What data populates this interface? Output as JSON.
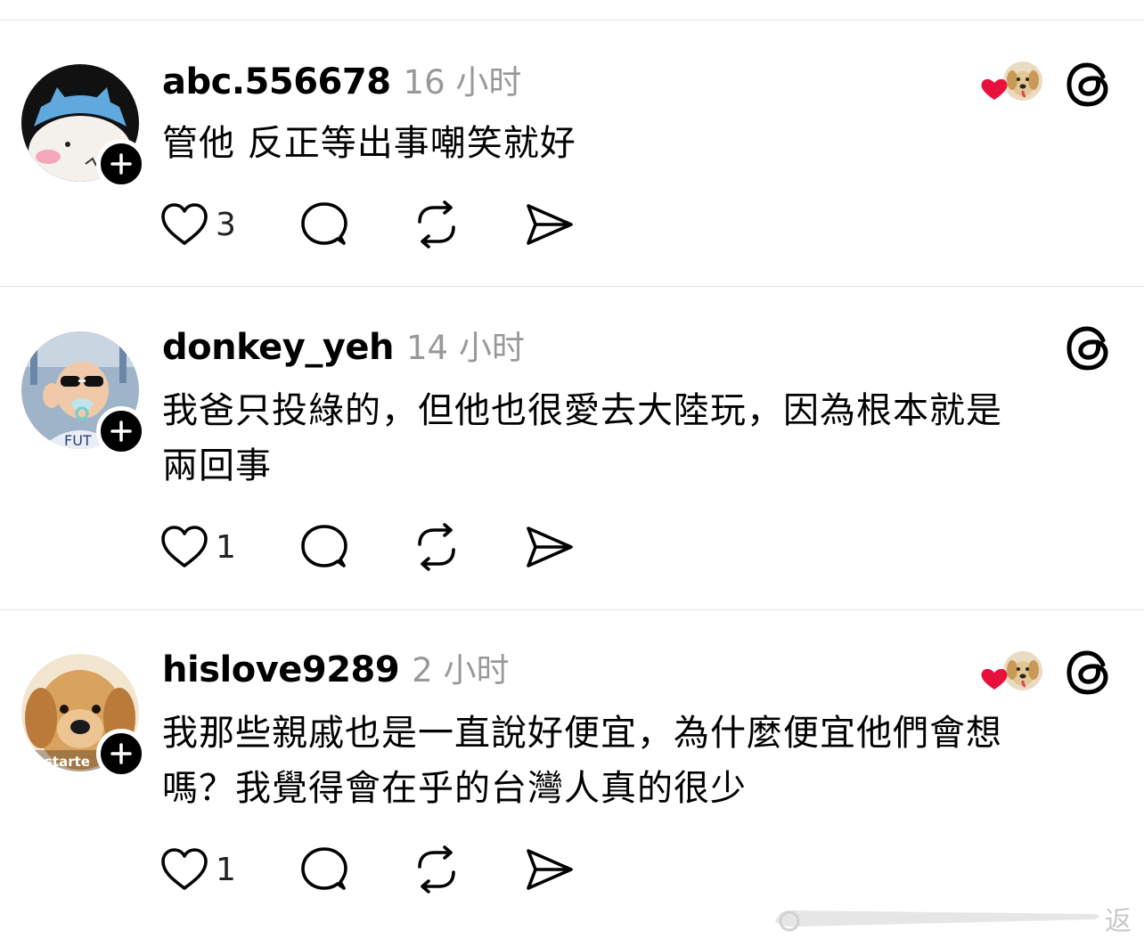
{
  "posts": [
    {
      "username": "abc.556678",
      "time": "16 小时",
      "text_lines": [
        "管他 反正等出事嘲笑就好"
      ],
      "like_count": "3",
      "liked_by_author": true,
      "avatar": "cartoon-cat-avatar"
    },
    {
      "username": "donkey_yeh",
      "time": "14 小时",
      "text_lines": [
        "我爸只投綠的，但他也很愛去大陸玩，因為根本就是",
        "兩回事"
      ],
      "like_count": "1",
      "liked_by_author": false,
      "avatar": "baby-sunglasses-avatar"
    },
    {
      "username": "hislove9289",
      "time": "2 小时",
      "text_lines": [
        "我那些親戚也是一直說好便宜，為什麼便宜他們會想",
        "嗎？我覺得會在乎的台灣人真的很少"
      ],
      "like_count": "1",
      "liked_by_author": true,
      "avatar": "golden-retriever-avatar",
      "avatar_text": "starte"
    }
  ],
  "icons": {
    "like": "heart-outline-icon",
    "reply": "speech-bubble-icon",
    "repost": "repost-arrows-icon",
    "share": "paper-plane-icon",
    "app": "threads-logo-icon",
    "follow": "plus-icon",
    "liked": "red-heart-icon"
  },
  "colors": {
    "heart_red": "#e8113b",
    "meta_gray": "#999999",
    "divider": "#e3e3e3"
  },
  "watermark_text": "返"
}
